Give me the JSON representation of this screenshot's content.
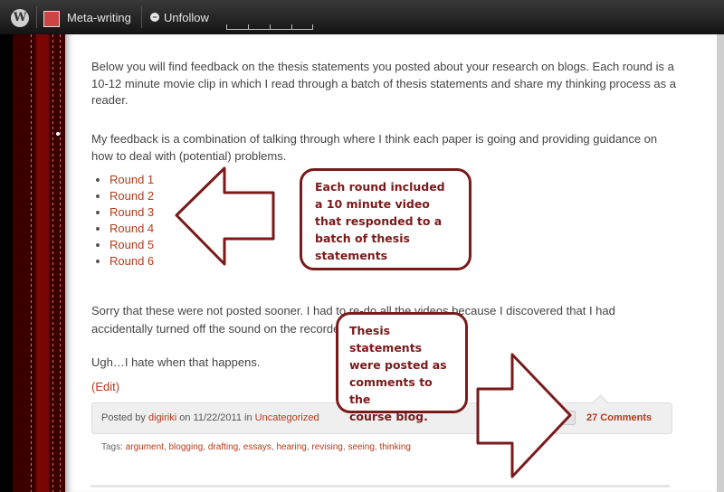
{
  "adminbar": {
    "site_name": "Meta-writing",
    "unfollow_label": "Unfollow"
  },
  "post": {
    "paragraph1": "Below you will find feedback on the thesis statements you posted about your research on blogs. Each round is a 10-12 minute movie clip in which I read through a batch of thesis statements and share my thinking process as a reader.",
    "paragraph2": "My feedback is a combination of talking through where I think each paper is going and providing guidance on how to deal with (potential) problems.",
    "rounds": [
      "Round 1",
      "Round 2",
      "Round 3",
      "Round 4",
      "Round 5",
      "Round 6"
    ],
    "paragraph3": "Sorry that these were not posted sooner. I had to re-do all the videos because I discovered that I had accidentally turned off the sound on the recorder.",
    "paragraph4": "Ugh…I hate when that happens.",
    "edit_label": "(Edit)"
  },
  "meta": {
    "posted_by": "Posted by",
    "author": "digiriki",
    "on_date": "on 11/22/2011 in",
    "category": "Uncategorized",
    "comments": "27 Comments",
    "tags_label": "Tags:",
    "tags": [
      "argument",
      "blogging",
      "drafting",
      "essays",
      "hearing",
      "revising",
      "seeing",
      "thinking"
    ]
  },
  "annotations": {
    "callout1": [
      "Each round included",
      "a 10 minute video",
      "that responded to a",
      "batch of thesis",
      "statements"
    ],
    "callout2": [
      "Thesis statements",
      "were posted as",
      "comments to the",
      "course blog."
    ],
    "color": "#7a1a1a"
  },
  "colors": {
    "link": "#b53a1c",
    "sidebar": "#3a0000"
  }
}
